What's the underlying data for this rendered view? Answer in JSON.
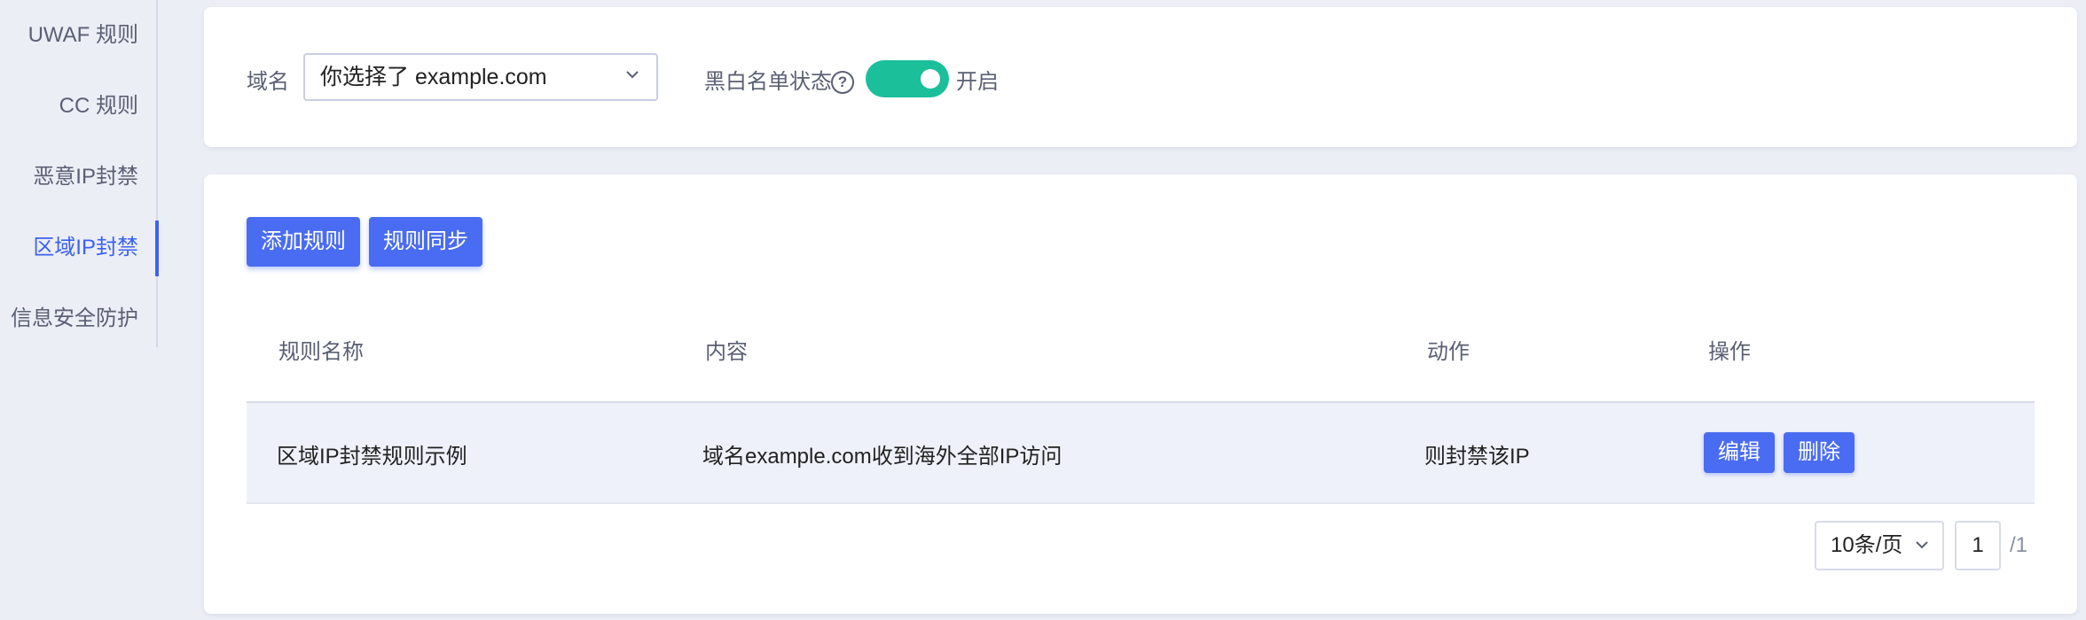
{
  "sidebar": {
    "items": [
      {
        "label": "UWAF 规则"
      },
      {
        "label": "CC 规则"
      },
      {
        "label": "恶意IP封禁"
      },
      {
        "label": "区域IP封禁"
      },
      {
        "label": "信息安全防护"
      }
    ],
    "active_index": 3
  },
  "filter": {
    "domain_label": "域名",
    "domain_value": "你选择了 example.com",
    "blacklist_label": "黑白名单状态",
    "help_icon_glyph": "?",
    "toggle_state_label": "开启",
    "toggle_color": "#1bbf9a"
  },
  "actions": {
    "add_rule": "添加规则",
    "sync_rules": "规则同步"
  },
  "table": {
    "headers": {
      "name": "规则名称",
      "content": "内容",
      "action": "动作",
      "operation": "操作"
    },
    "rows": [
      {
        "name": "区域IP封禁规则示例",
        "content": "域名example.com收到海外全部IP访问",
        "action": "则封禁该IP",
        "edit_label": "编辑",
        "delete_label": "删除"
      }
    ]
  },
  "pagination": {
    "page_size": "10条/页",
    "current_page": "1",
    "total_pages": "/1"
  },
  "colors": {
    "accent": "#4a6cf2",
    "active_nav": "#3b62f2",
    "toggle_on": "#1bbf9a"
  }
}
